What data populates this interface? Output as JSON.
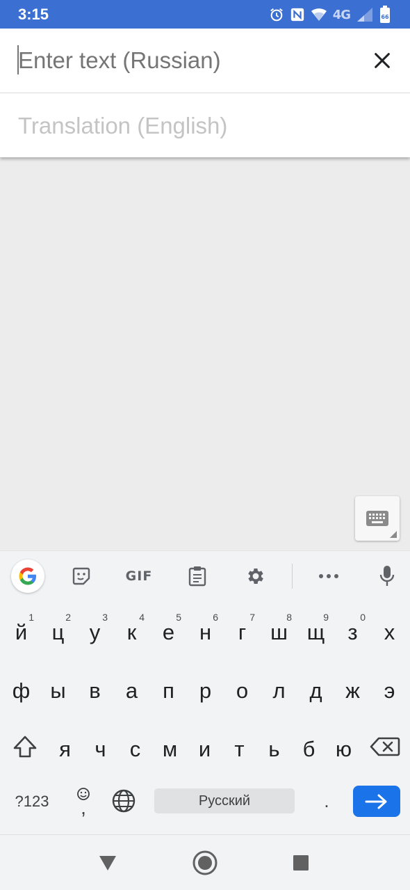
{
  "status_bar": {
    "time": "3:15",
    "network_label": "4G",
    "battery_level": "66",
    "icons": [
      "alarm-icon",
      "nfc-icon",
      "wifi-icon",
      "signal-icon",
      "battery-icon"
    ]
  },
  "input": {
    "placeholder": "Enter text (Russian)",
    "value": "",
    "clear_icon": "close-icon"
  },
  "translation": {
    "placeholder": "Translation (English)"
  },
  "keyboard_toggle": {
    "icon": "keyboard-icon"
  },
  "keyboard": {
    "toolbar": {
      "gif_label": "GIF",
      "icons": [
        "google-icon",
        "sticker-icon",
        "gif-icon",
        "clipboard-icon",
        "settings-icon",
        "more-icon",
        "mic-icon"
      ]
    },
    "row1": [
      {
        "char": "й",
        "hint": "1"
      },
      {
        "char": "ц",
        "hint": "2"
      },
      {
        "char": "у",
        "hint": "3"
      },
      {
        "char": "к",
        "hint": "4"
      },
      {
        "char": "е",
        "hint": "5"
      },
      {
        "char": "н",
        "hint": "6"
      },
      {
        "char": "г",
        "hint": "7"
      },
      {
        "char": "ш",
        "hint": "8"
      },
      {
        "char": "щ",
        "hint": "9"
      },
      {
        "char": "з",
        "hint": "0"
      },
      {
        "char": "х",
        "hint": ""
      }
    ],
    "row2": [
      "ф",
      "ы",
      "в",
      "а",
      "п",
      "р",
      "о",
      "л",
      "д",
      "ж",
      "э"
    ],
    "row3": [
      "я",
      "ч",
      "с",
      "м",
      "и",
      "т",
      "ь",
      "б",
      "ю"
    ],
    "symbols_label": "?123",
    "comma_label": ",",
    "space_label": "Русский",
    "period_label": ".",
    "enter_icon": "arrow-right-icon"
  },
  "nav_bar": {
    "icons": [
      "back-icon",
      "home-icon",
      "recents-icon"
    ]
  },
  "colors": {
    "status_bar": "#3b6fd1",
    "enter_key": "#1a73e8",
    "background": "#ececec"
  }
}
